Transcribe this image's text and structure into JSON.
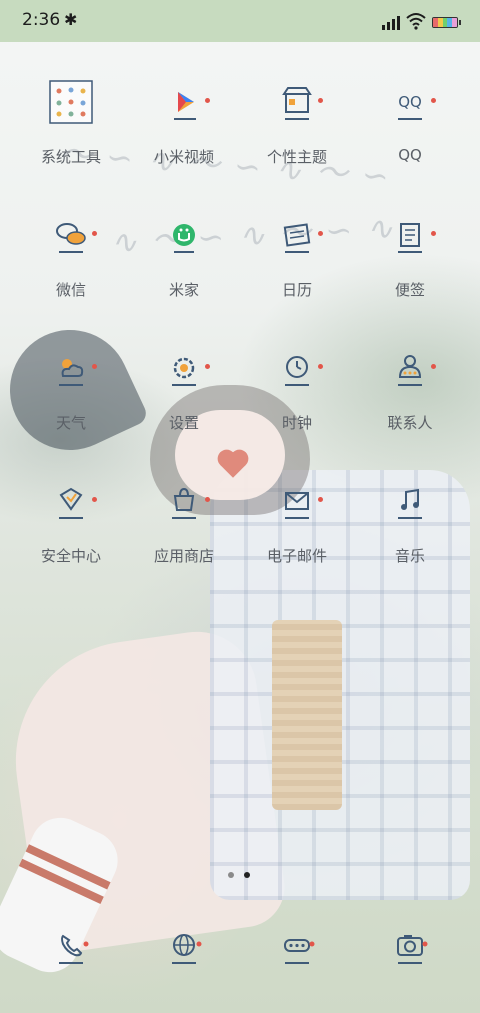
{
  "status_bar": {
    "time": "2:36"
  },
  "apps": [
    {
      "label": "系统工具",
      "icon": "folder-icon"
    },
    {
      "label": "小米视频",
      "icon": "video-play-icon"
    },
    {
      "label": "个性主题",
      "icon": "theme-store-icon"
    },
    {
      "label": "QQ",
      "icon": "qq-icon"
    },
    {
      "label": "微信",
      "icon": "wechat-icon"
    },
    {
      "label": "米家",
      "icon": "mijia-icon"
    },
    {
      "label": "日历",
      "icon": "calendar-icon"
    },
    {
      "label": "便签",
      "icon": "notes-icon"
    },
    {
      "label": "天气",
      "icon": "weather-icon"
    },
    {
      "label": "设置",
      "icon": "settings-icon"
    },
    {
      "label": "时钟",
      "icon": "clock-icon"
    },
    {
      "label": "联系人",
      "icon": "contacts-icon"
    },
    {
      "label": "安全中心",
      "icon": "security-icon"
    },
    {
      "label": "应用商店",
      "icon": "app-store-icon"
    },
    {
      "label": "电子邮件",
      "icon": "email-icon"
    },
    {
      "label": "音乐",
      "icon": "music-icon"
    }
  ],
  "dock": [
    {
      "icon": "phone-icon"
    },
    {
      "icon": "browser-icon"
    },
    {
      "icon": "messages-icon"
    },
    {
      "icon": "camera-icon"
    }
  ],
  "page_indicator": {
    "pages": 2,
    "current": 2
  },
  "colors": {
    "status_bar_bg": "#c7dbbf",
    "icon_stroke": "#3f5a78",
    "badge_red": "#e2564a",
    "mijia_green": "#2fb66b"
  }
}
